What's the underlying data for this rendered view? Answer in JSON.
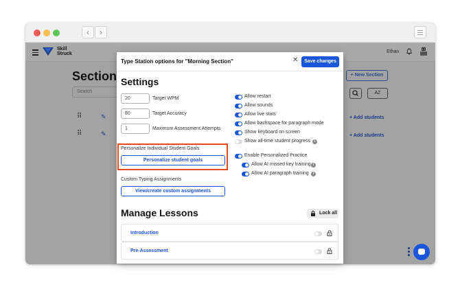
{
  "browser": {
    "back_glyph": "‹",
    "forward_glyph": "›"
  },
  "app": {
    "brand_line1": "Skill",
    "brand_line2": "Struck",
    "user_name": "Ethan",
    "page_title": "Sections",
    "search_placeholder": "Search",
    "new_section_label": "+ New Section",
    "sort_label": "AZ",
    "add_students_label": "+ Add students",
    "drag_glyph": "⠿",
    "edit_glyph": "✎"
  },
  "modal": {
    "title": "Type Station options for \"Morning Section\"",
    "close_glyph": "✕",
    "save_label": "Save changes",
    "settings_heading": "Settings",
    "inputs": [
      {
        "value": "20",
        "label": "Target WPM"
      },
      {
        "value": "80",
        "label": "Target Accuracy"
      },
      {
        "value": "1",
        "label": "Maximum Assessment Attempts"
      }
    ],
    "toggles": [
      {
        "label": "Allow restart",
        "on": true,
        "info": false
      },
      {
        "label": "Allow sounds",
        "on": true,
        "info": false
      },
      {
        "label": "Allow live stats",
        "on": true,
        "info": false
      },
      {
        "label": "Allow backspace for paragraph mode",
        "on": true,
        "info": false
      },
      {
        "label": "Show keyboard on screen",
        "on": true,
        "info": false
      },
      {
        "label": "Show all-time student progress",
        "on": false,
        "info": true
      },
      {
        "label": "Enable Personalized Practice",
        "on": true,
        "info": false
      },
      {
        "label": "Allow AI missed key training",
        "on": true,
        "info": true
      },
      {
        "label": "Allow AI paragraph training",
        "on": true,
        "info": true
      }
    ],
    "info_glyph": "i",
    "personalize_label": "Personalize Individual Student Goals",
    "personalize_button": "Personalize student goals",
    "custom_label": "Custom Typing Assignments",
    "custom_button": "View/create custom assignments",
    "lessons_heading": "Manage Lessons",
    "lock_all_label": "Lock all",
    "lessons": [
      {
        "label": "Introduction"
      },
      {
        "label": "Pre-Assessment"
      }
    ]
  },
  "colors": {
    "accent": "#1a56db",
    "highlight": "#e84a1f",
    "overlay": "#a3a3a3"
  }
}
